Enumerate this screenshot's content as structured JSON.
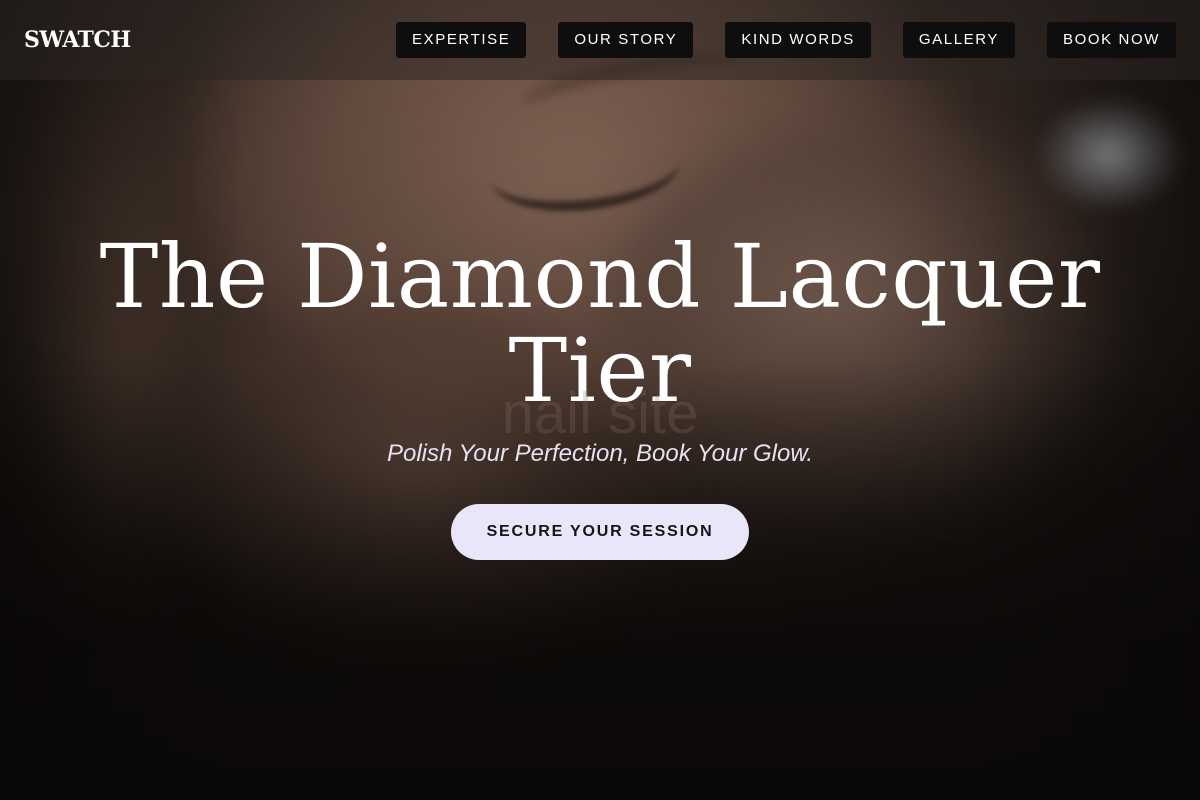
{
  "brand": {
    "logo_text": "SWATCH"
  },
  "nav": {
    "items": [
      {
        "label": "EXPERTISE"
      },
      {
        "label": "OUR STORY"
      },
      {
        "label": "KIND WORDS"
      },
      {
        "label": "GALLERY"
      },
      {
        "label": "BOOK NOW"
      }
    ]
  },
  "hero": {
    "title": "The Diamond Lacquer Tier",
    "background_watermark": "nail site",
    "tagline": "Polish Your Perfection, Book Your Glow.",
    "cta_label": "SECURE YOUR SESSION"
  },
  "colors": {
    "nav_button_bg": "#0e0e0e",
    "cta_bg": "#e8e6f8",
    "cta_text": "#141414",
    "tagline": "#e6e2f2",
    "text_primary": "#ffffff"
  }
}
